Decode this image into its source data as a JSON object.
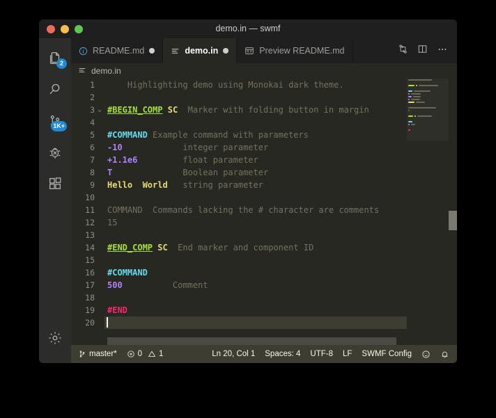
{
  "window": {
    "title": "demo.in — swmf",
    "traffic_lights": [
      {
        "name": "close",
        "color": "#ed6a5e"
      },
      {
        "name": "minimize",
        "color": "#f5bf4f"
      },
      {
        "name": "zoom",
        "color": "#61c554"
      }
    ]
  },
  "activity_bar": {
    "items": [
      {
        "name": "explorer",
        "icon": "files-icon",
        "badge": "2"
      },
      {
        "name": "search",
        "icon": "search-icon",
        "badge": ""
      },
      {
        "name": "source-control",
        "icon": "source-control-icon",
        "badge": "1K+"
      },
      {
        "name": "run-and-debug",
        "icon": "debug-icon",
        "badge": ""
      },
      {
        "name": "extensions",
        "icon": "extensions-icon",
        "badge": ""
      }
    ],
    "bottom_items": [
      {
        "name": "manage-settings",
        "icon": "gear-icon"
      }
    ]
  },
  "tabs": [
    {
      "label": "README.md",
      "icon": "info-icon",
      "dirty": true,
      "active": false
    },
    {
      "label": "demo.in",
      "icon": "list-icon",
      "dirty": true,
      "active": true
    },
    {
      "label": "Preview README.md",
      "icon": "preview-icon",
      "dirty": false,
      "active": false
    }
  ],
  "tab_actions": [
    {
      "name": "compare-changes",
      "icon": "compare-icon"
    },
    {
      "name": "split-editor",
      "icon": "split-editor-icon"
    },
    {
      "name": "more-actions",
      "icon": "ellipsis-icon"
    }
  ],
  "breadcrumb": {
    "icon": "list-icon",
    "label": "demo.in"
  },
  "editor": {
    "language_theme": "Monokai dark",
    "lines": [
      {
        "n": "1",
        "fold": "",
        "tokens": [
          {
            "t": "    ",
            "c": "plain"
          },
          {
            "t": "Highlighting demo using Monokai dark theme.",
            "c": "comment"
          }
        ]
      },
      {
        "n": "2",
        "fold": "",
        "tokens": []
      },
      {
        "n": "3",
        "fold": "v",
        "tokens": [
          {
            "t": "#BEGIN_COMP",
            "c": "green"
          },
          {
            "t": " ",
            "c": "plain"
          },
          {
            "t": "SC",
            "c": "yellow"
          },
          {
            "t": "  Marker with folding button in margin",
            "c": "comment"
          }
        ]
      },
      {
        "n": "4",
        "fold": "",
        "tokens": []
      },
      {
        "n": "5",
        "fold": "",
        "tokens": [
          {
            "t": "#COMMAND",
            "c": "cyan"
          },
          {
            "t": " Example command with parameters",
            "c": "comment"
          }
        ]
      },
      {
        "n": "6",
        "fold": "",
        "tokens": [
          {
            "t": "-10",
            "c": "purple"
          },
          {
            "t": "            integer parameter",
            "c": "comment"
          }
        ]
      },
      {
        "n": "7",
        "fold": "",
        "tokens": [
          {
            "t": "+1.1e6",
            "c": "purple"
          },
          {
            "t": "         float parameter",
            "c": "comment"
          }
        ]
      },
      {
        "n": "8",
        "fold": "",
        "tokens": [
          {
            "t": "T",
            "c": "purple"
          },
          {
            "t": "              Boolean parameter",
            "c": "comment"
          }
        ]
      },
      {
        "n": "9",
        "fold": "",
        "tokens": [
          {
            "t": "Hello  World",
            "c": "yellow"
          },
          {
            "t": "   string parameter",
            "c": "comment"
          }
        ]
      },
      {
        "n": "10",
        "fold": "",
        "tokens": []
      },
      {
        "n": "11",
        "fold": "",
        "tokens": [
          {
            "t": "COMMAND  Commands lacking the # character are comments",
            "c": "comment"
          }
        ]
      },
      {
        "n": "12",
        "fold": "",
        "tokens": [
          {
            "t": "15",
            "c": "comment"
          }
        ]
      },
      {
        "n": "13",
        "fold": "",
        "tokens": []
      },
      {
        "n": "14",
        "fold": "",
        "tokens": [
          {
            "t": "#END_COMP",
            "c": "green"
          },
          {
            "t": " ",
            "c": "plain"
          },
          {
            "t": "SC",
            "c": "yellow"
          },
          {
            "t": "  End marker and component ID",
            "c": "comment"
          }
        ]
      },
      {
        "n": "15",
        "fold": "",
        "tokens": []
      },
      {
        "n": "16",
        "fold": "",
        "tokens": [
          {
            "t": "#COMMAND",
            "c": "cyan"
          }
        ]
      },
      {
        "n": "17",
        "fold": "",
        "tokens": [
          {
            "t": "500",
            "c": "purple"
          },
          {
            "t": "          Comment",
            "c": "comment"
          }
        ]
      },
      {
        "n": "18",
        "fold": "",
        "tokens": []
      },
      {
        "n": "19",
        "fold": "",
        "tokens": [
          {
            "t": "#END",
            "c": "pink"
          }
        ]
      },
      {
        "n": "20",
        "fold": "",
        "tokens": [],
        "active": true,
        "cursor": true
      }
    ]
  },
  "status_bar": {
    "branch": "master*",
    "branch_icon": "source-control-icon",
    "errors": "0",
    "errors_icon": "error-icon",
    "warnings": "1",
    "warnings_icon": "warning-icon",
    "position": "Ln 20, Col 1",
    "indentation": "Spaces: 4",
    "encoding": "UTF-8",
    "eol": "LF",
    "language_mode": "SWMF Config",
    "feedback_icon": "smiley-icon",
    "notifications_icon": "bell-icon"
  },
  "colors": {
    "editor_background": "#272822",
    "accent_badge": "#1f8ad2",
    "status_bar": "#3e3d32",
    "green": "#a6e22e",
    "yellow": "#e6db74",
    "cyan": "#66d9ef",
    "purple": "#ae81ff",
    "pink": "#f92672",
    "comment": "#75715e"
  }
}
